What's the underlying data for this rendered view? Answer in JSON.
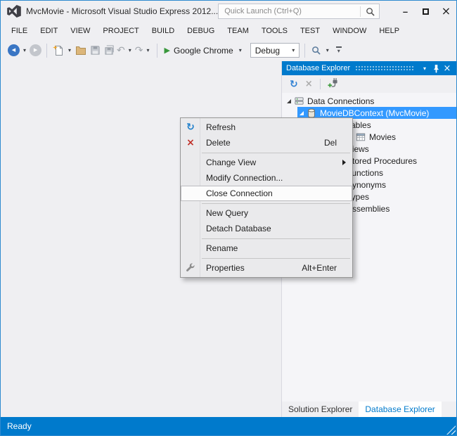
{
  "title_bar": {
    "title": "MvcMovie - Microsoft Visual Studio Express 2012...",
    "quick_launch": "Quick Launch (Ctrl+Q)"
  },
  "menu_bar": {
    "items": [
      "FILE",
      "EDIT",
      "VIEW",
      "PROJECT",
      "BUILD",
      "DEBUG",
      "TEAM",
      "TOOLS",
      "TEST",
      "WINDOW",
      "HELP"
    ]
  },
  "toolbar": {
    "run_target": "Google Chrome",
    "configuration": "Debug"
  },
  "database_explorer": {
    "title": "Database Explorer",
    "tree_items": [
      "Data Connections",
      "MovieDBContext (MvcMovie)",
      "Tables",
      "Movies",
      "Views",
      "Stored Procedures",
      "Functions",
      "Synonyms",
      "Types",
      "Assemblies"
    ]
  },
  "context_menu": {
    "items": [
      {
        "label": "Refresh"
      },
      {
        "label": "Delete",
        "shortcut": "Del"
      },
      {
        "label": "Change View"
      },
      {
        "label": "Modify Connection..."
      },
      {
        "label": "Close Connection"
      },
      {
        "label": "New Query"
      },
      {
        "label": "Detach Database"
      },
      {
        "label": "Rename"
      },
      {
        "label": "Properties",
        "shortcut": "Alt+Enter"
      }
    ]
  },
  "bottom_tabs": {
    "items": [
      "Solution Explorer",
      "Database Explorer"
    ],
    "active": "Database Explorer"
  },
  "status_bar": {
    "text": "Ready"
  },
  "icons": {
    "dropdown_caret": "▾",
    "back_arrow": "◀",
    "forward_arrow": "▶",
    "undo": "↶",
    "redo": "↷",
    "play": "▶",
    "refresh": "↻",
    "delete_x": "×",
    "close_x": "×",
    "minimize": "–",
    "collapsed_arrow": "▷",
    "overflow_caret": "▾"
  },
  "colors": {
    "accent": "#007ACC",
    "selection": "#3399FF",
    "chrome": "#EFEFF2"
  }
}
